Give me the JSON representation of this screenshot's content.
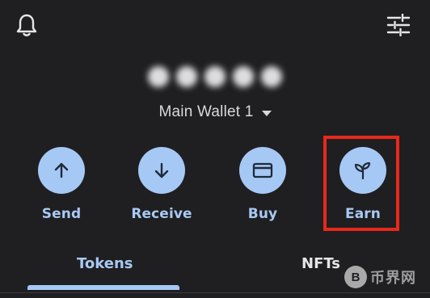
{
  "header": {
    "left_icon": "bell-icon",
    "right_icon": "sliders-icon"
  },
  "wallet": {
    "name": "Main Wallet 1",
    "balance_hidden": true,
    "dropdown_icon": "caret-down-icon"
  },
  "actions": [
    {
      "label": "Send",
      "icon": "arrow-up-icon"
    },
    {
      "label": "Receive",
      "icon": "arrow-down-icon"
    },
    {
      "label": "Buy",
      "icon": "card-icon"
    },
    {
      "label": "Earn",
      "icon": "sprout-icon"
    }
  ],
  "tabs": [
    {
      "label": "Tokens",
      "active": true
    },
    {
      "label": "NFTs",
      "active": false
    }
  ],
  "watermark": {
    "badge": "B",
    "text": "币界网"
  },
  "colors": {
    "background": "#1f1f21",
    "accent": "#a6c8f5",
    "accent_text": "#a9c9f2",
    "highlight": "#e8281c"
  }
}
